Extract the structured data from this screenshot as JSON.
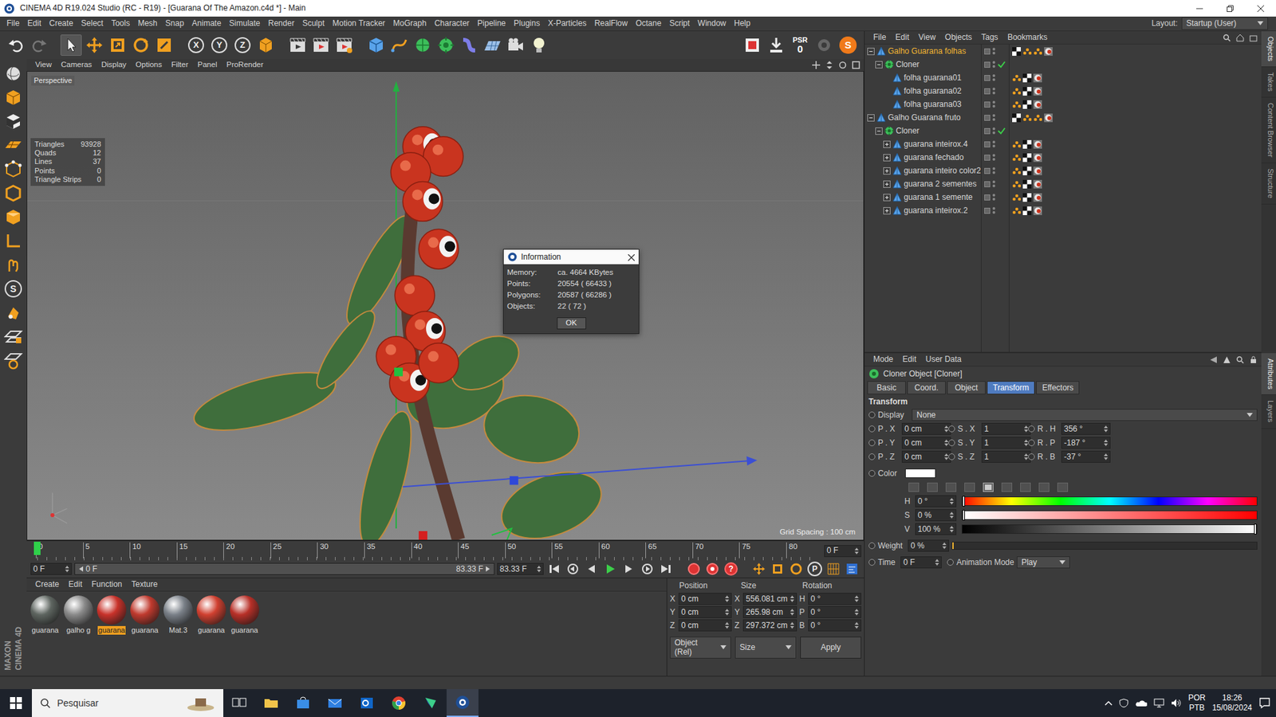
{
  "window": {
    "title": "CINEMA 4D R19.024 Studio (RC - R19) - [Guarana Of The Amazon.c4d *] - Main"
  },
  "menu": [
    "File",
    "Edit",
    "Create",
    "Select",
    "Tools",
    "Mesh",
    "Snap",
    "Animate",
    "Simulate",
    "Render",
    "Sculpt",
    "Motion Tracker",
    "MoGraph",
    "Character",
    "Pipeline",
    "Plugins",
    "X-Particles",
    "RealFlow",
    "Octane",
    "Script",
    "Window",
    "Help"
  ],
  "layout": {
    "label": "Layout:",
    "value": "Startup (User)"
  },
  "toolbar": {
    "axes": [
      "X",
      "Y",
      "Z"
    ],
    "psr_label": "PSR",
    "psr_value": "0",
    "snap_glyph": "S"
  },
  "left_tools": {
    "glyph": "S"
  },
  "brand": {
    "maker": "MAXON",
    "product": "CINEMA 4D"
  },
  "viewport": {
    "menu": [
      "View",
      "Cameras",
      "Display",
      "Options",
      "Filter",
      "Panel",
      "ProRender"
    ],
    "camera": "Perspective",
    "stats": [
      {
        "label": "Triangles",
        "value": "93928"
      },
      {
        "label": "Quads",
        "value": "12"
      },
      {
        "label": "Lines",
        "value": "37"
      },
      {
        "label": "Points",
        "value": "0"
      },
      {
        "label": "Triangle Strips",
        "value": "0"
      }
    ],
    "grid_spacing": "Grid Spacing : 100 cm"
  },
  "info_dialog": {
    "title": "Information",
    "rows": [
      {
        "label": "Memory:",
        "value": "ca. 4664 KBytes"
      },
      {
        "label": "Points:",
        "value": "20554 ( 66433 )"
      },
      {
        "label": "Polygons:",
        "value": "20587 ( 66286 )"
      },
      {
        "label": "Objects:",
        "value": "22 ( 72 )"
      }
    ],
    "button": "OK"
  },
  "timeline": {
    "ticks": [
      "0",
      "5",
      "10",
      "15",
      "20",
      "25",
      "30",
      "35",
      "40",
      "45",
      "50",
      "55",
      "60",
      "65",
      "70",
      "75",
      "80"
    ],
    "frame": "0 F",
    "level": 0,
    "start": "0 F",
    "range_start": "0 F",
    "range_end": "83.33 F",
    "end": "83.33 F",
    "range_level": 1,
    "record_glyph": "?",
    "param_glyph": "P"
  },
  "materials": {
    "menu": [
      "Create",
      "Edit",
      "Function",
      "Texture"
    ],
    "items": [
      {
        "label": "guarana",
        "selected": false,
        "color": "#5e6560"
      },
      {
        "label": "galho g",
        "selected": false,
        "color": "#8a8a8a"
      },
      {
        "label": "guarana",
        "selected": true,
        "color": "#c8322a"
      },
      {
        "label": "guarana",
        "selected": false,
        "color": "#c03a2e"
      },
      {
        "label": "Mat.3",
        "selected": false,
        "color": "#7a8088"
      },
      {
        "label": "guarana",
        "selected": false,
        "color": "#d04030"
      },
      {
        "label": "guarana",
        "selected": false,
        "color": "#b83028"
      }
    ]
  },
  "coordinates": {
    "headers": [
      "Position",
      "Size",
      "Rotation"
    ],
    "rows": [
      {
        "axis": "X",
        "position": "0 cm",
        "size_axis": "X",
        "size": "556.081 cm",
        "rotation_axis": "H",
        "rotation": "0 °"
      },
      {
        "axis": "Y",
        "position": "0 cm",
        "size_axis": "Y",
        "size": "265.98 cm",
        "rotation_axis": "P",
        "rotation": "0 °"
      },
      {
        "axis": "Z",
        "position": "0 cm",
        "size_axis": "Z",
        "size": "297.372 cm",
        "rotation_axis": "B",
        "rotation": "0 °"
      }
    ],
    "mode": "Object (Rel)",
    "size_mode": "Size",
    "apply": "Apply"
  },
  "objects": {
    "menu": [
      "File",
      "Edit",
      "View",
      "Objects",
      "Tags",
      "Bookmarks"
    ],
    "items": [
      {
        "name": "Galho Guarana folhas",
        "depth": 0,
        "kind": "polygon",
        "has_children": true,
        "expanded": true,
        "selected": true,
        "check": false
      },
      {
        "name": "Cloner",
        "depth": 1,
        "kind": "cloner",
        "has_children": true,
        "expanded": true,
        "selected": false,
        "check": true
      },
      {
        "name": "folha guarana01",
        "depth": 2,
        "kind": "polygon",
        "has_children": false,
        "expanded": false,
        "selected": false,
        "check": false
      },
      {
        "name": "folha guarana02",
        "depth": 2,
        "kind": "polygon",
        "has_children": false,
        "expanded": false,
        "selected": false,
        "check": false
      },
      {
        "name": "folha guarana03",
        "depth": 2,
        "kind": "polygon",
        "has_children": false,
        "expanded": false,
        "selected": false,
        "check": false
      },
      {
        "name": "Galho Guarana fruto",
        "depth": 0,
        "kind": "polygon",
        "has_children": true,
        "expanded": true,
        "selected": false,
        "check": false
      },
      {
        "name": "Cloner",
        "depth": 1,
        "kind": "cloner",
        "has_children": true,
        "expanded": true,
        "selected": false,
        "check": true
      },
      {
        "name": "guarana inteirox.4",
        "depth": 2,
        "kind": "polygon",
        "has_children": true,
        "expanded": false,
        "selected": false,
        "check": false
      },
      {
        "name": "guarana fechado",
        "depth": 2,
        "kind": "polygon",
        "has_children": true,
        "expanded": false,
        "selected": false,
        "check": false
      },
      {
        "name": "guarana inteiro color2",
        "depth": 2,
        "kind": "polygon",
        "has_children": true,
        "expanded": false,
        "selected": false,
        "check": false
      },
      {
        "name": "guarana 2 sementes",
        "depth": 2,
        "kind": "polygon",
        "has_children": true,
        "expanded": false,
        "selected": false,
        "check": false
      },
      {
        "name": "guarana 1 semente",
        "depth": 2,
        "kind": "polygon",
        "has_children": true,
        "expanded": false,
        "selected": false,
        "check": false
      },
      {
        "name": "guarana inteirox.2",
        "depth": 2,
        "kind": "polygon",
        "has_children": true,
        "expanded": false,
        "selected": false,
        "check": false
      }
    ]
  },
  "attributes": {
    "menu": [
      "Mode",
      "Edit",
      "User Data"
    ],
    "title": "Cloner Object [Cloner]",
    "tabs": [
      {
        "label": "Basic",
        "selected": false
      },
      {
        "label": "Coord.",
        "selected": false
      },
      {
        "label": "Object",
        "selected": false
      },
      {
        "label": "Transform",
        "selected": true
      },
      {
        "label": "Effectors",
        "selected": false
      }
    ],
    "section": "Transform",
    "display": {
      "label": "Display",
      "value": "None"
    },
    "fields": [
      [
        {
          "label": "P . X",
          "value": "0 cm"
        },
        {
          "label": "S . X",
          "value": "1"
        },
        {
          "label": "R . H",
          "value": "356 °"
        }
      ],
      [
        {
          "label": "P . Y",
          "value": "0 cm"
        },
        {
          "label": "S . Y",
          "value": "1"
        },
        {
          "label": "R . P",
          "value": "-187 °"
        }
      ],
      [
        {
          "label": "P . Z",
          "value": "0 cm"
        },
        {
          "label": "S . Z",
          "value": "1"
        },
        {
          "label": "R . B",
          "value": "-37 °"
        }
      ]
    ],
    "color": {
      "label": "Color",
      "value": "#ffffff"
    },
    "hsv": [
      {
        "label": "H",
        "value": "0 °",
        "level": 0,
        "kind": "hue"
      },
      {
        "label": "S",
        "value": "0 %",
        "level": 0,
        "kind": "saturation"
      },
      {
        "label": "V",
        "value": "100 %",
        "level": 1,
        "kind": "value"
      }
    ],
    "weight": {
      "label": "Weight",
      "value": "0 %",
      "level": 0
    },
    "time": {
      "label": "Time",
      "value": "0 F"
    },
    "animation_mode": {
      "label": "Animation Mode",
      "value": "Play"
    }
  },
  "side_tabs": {
    "top": [
      {
        "label": "Objects",
        "selected": true
      },
      {
        "label": "Takes",
        "selected": false
      },
      {
        "label": "Content Browser",
        "selected": false
      },
      {
        "label": "Structure",
        "selected": false
      }
    ],
    "bottom": [
      {
        "label": "Attributes",
        "selected": true
      },
      {
        "label": "Layers",
        "selected": false
      }
    ]
  },
  "taskbar": {
    "search": "Pesquisar",
    "language": "POR",
    "keyboard": "PTB",
    "time": "18:26",
    "date": "15/08/2024"
  }
}
